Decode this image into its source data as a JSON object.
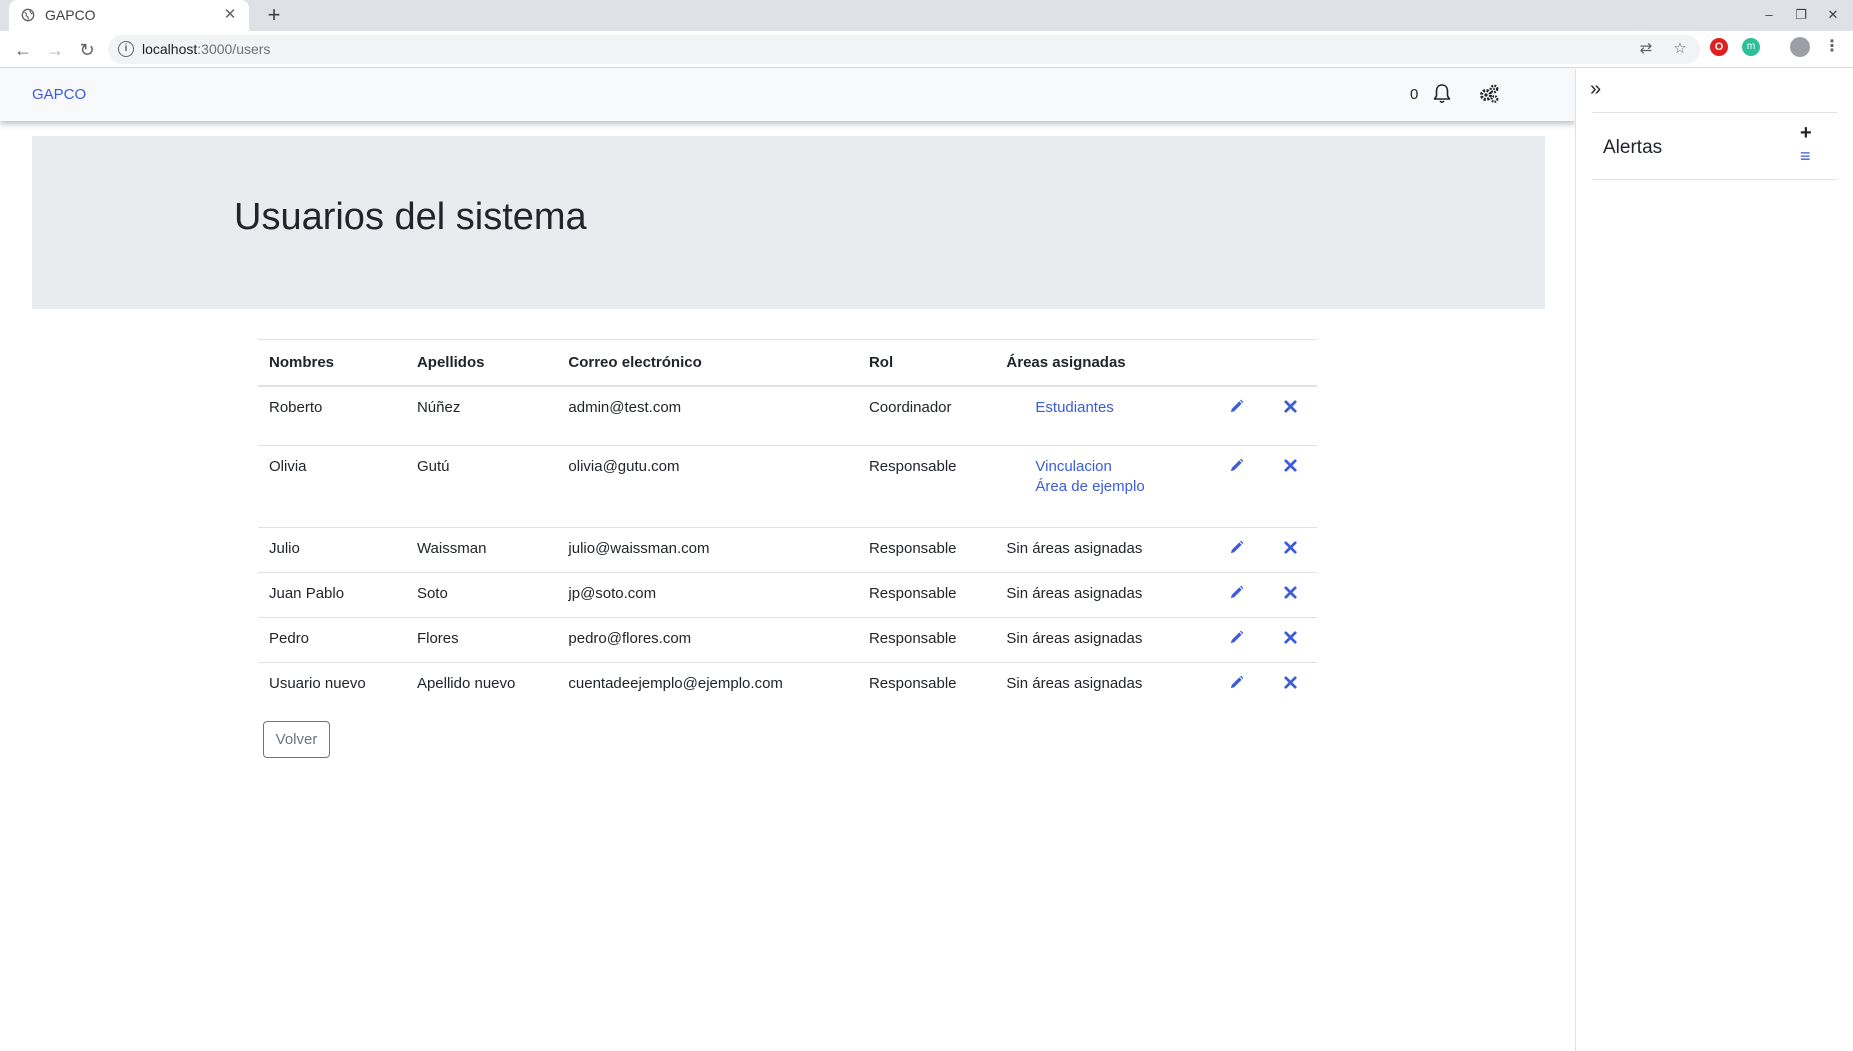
{
  "browser": {
    "tab_title": "GAPCO",
    "tab_close": "✕",
    "new_tab": "+",
    "url_host": "localhost",
    "url_path": ":3000/users",
    "window_controls": [
      "–",
      "❐",
      "✕"
    ]
  },
  "navbar": {
    "brand": "GAPCO",
    "notification_count": "0",
    "icons": [
      "bell-icon",
      "gears-icon"
    ]
  },
  "page": {
    "title": "Usuarios del sistema"
  },
  "table": {
    "headers": [
      "Nombres",
      "Apellidos",
      "Correo electrónico",
      "Rol",
      "Áreas asignadas"
    ],
    "rows": [
      {
        "nombres": "Roberto",
        "apellidos": "Núñez",
        "correo": "admin@test.com",
        "rol": "Coordinador",
        "areas": [
          "Estudiantes"
        ]
      },
      {
        "nombres": "Olivia",
        "apellidos": "Gutú",
        "correo": "olivia@gutu.com",
        "rol": "Responsable",
        "areas": [
          "Vinculacion",
          "Área de ejemplo"
        ]
      },
      {
        "nombres": "Julio",
        "apellidos": "Waissman",
        "correo": "julio@waissman.com",
        "rol": "Responsable",
        "areas_text": "Sin áreas asignadas"
      },
      {
        "nombres": "Juan Pablo",
        "apellidos": "Soto",
        "correo": "jp@soto.com",
        "rol": "Responsable",
        "areas_text": "Sin áreas asignadas"
      },
      {
        "nombres": "Pedro",
        "apellidos": "Flores",
        "correo": "pedro@flores.com",
        "rol": "Responsable",
        "areas_text": "Sin áreas asignadas"
      },
      {
        "nombres": "Usuario nuevo",
        "apellidos": "Apellido nuevo",
        "correo": "cuentadeejemplo@ejemplo.com",
        "rol": "Responsable",
        "areas_text": "Sin áreas asignadas"
      }
    ]
  },
  "back_button": "Volver",
  "sidebar": {
    "collapse": "»",
    "title": "Alertas",
    "add": "+",
    "list": "≡"
  },
  "colors": {
    "link": "#3b5bdb",
    "navbar_bg": "#f8f9fa",
    "jumbotron_bg": "#e9ecef"
  }
}
